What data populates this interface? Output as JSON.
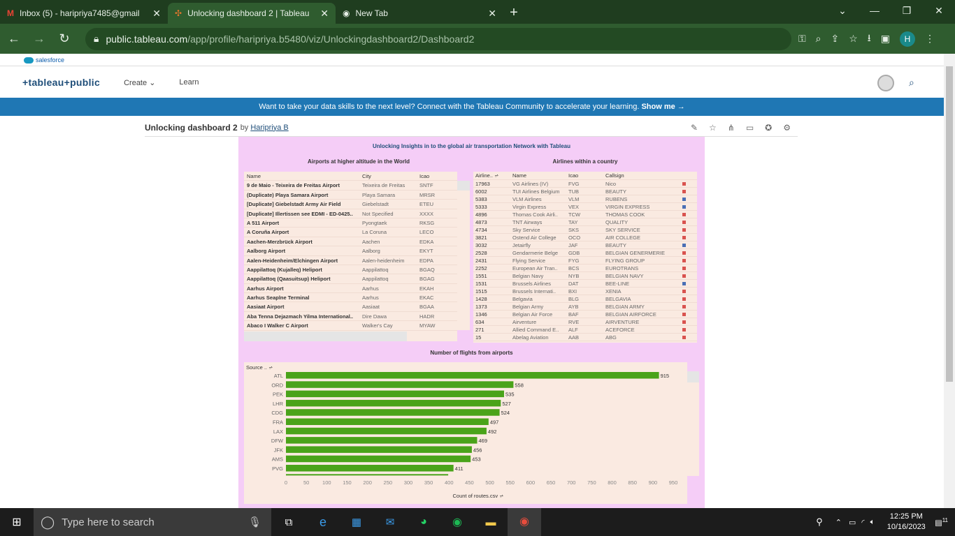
{
  "browser": {
    "tabs": [
      {
        "label": "Inbox (5) - haripriya7485@gmail",
        "icon": "gmail-icon"
      },
      {
        "label": "Unlocking dashboard 2 | Tableau",
        "icon": "tableau-icon"
      },
      {
        "label": "New Tab",
        "icon": "chrome-icon"
      }
    ],
    "url_host": "public.tableau.com",
    "url_path": "/app/profile/haripriya.b5480/viz/Unlockingdashboard2/Dashboard2",
    "profile_initial": "H"
  },
  "site": {
    "salesforce": "salesforce",
    "logo": "+tableau+public",
    "nav_create": "Create",
    "nav_learn": "Learn",
    "banner_text": "Want to take your data skills to the next level? Connect with the Tableau Community to accelerate your learning.",
    "banner_link": "Show me →"
  },
  "viz": {
    "title": "Unlocking dashboard 2",
    "by": "by",
    "author": "Haripriya B"
  },
  "dashboard": {
    "title": "Unlocking Insights in to the global air transportation  Network with Tableau",
    "airports_title": "Airports at higher altitude in the World",
    "airlines_title": "Airlines within a country",
    "flights_title": "Number of flights from airports"
  },
  "airports": {
    "headers": [
      "Name",
      "City",
      "Icao"
    ],
    "rows": [
      [
        "9 de Maio - Teixeira de Freitas Airport",
        "Teixeira de Freitas",
        "SNTF"
      ],
      [
        "(Duplicate) Playa Samara Airport",
        "Playa Samara",
        "MRSR"
      ],
      [
        "[Duplicate] Giebelstadt Army Air Field",
        "Giebelstadt",
        "ETEU"
      ],
      [
        "[Duplicate] Illertissen see EDMI - ED-0425..",
        "Not Specified",
        "XXXX"
      ],
      [
        "A 511 Airport",
        "Pyongtaek",
        "RKSG"
      ],
      [
        "A Coruña Airport",
        "La Coruna",
        "LECO"
      ],
      [
        "Aachen-Merzbrück Airport",
        "Aachen",
        "EDKA"
      ],
      [
        "Aalborg Airport",
        "Aalborg",
        "EKYT"
      ],
      [
        "Aalen-Heidenheim/Elchingen Airport",
        "Aalen-heidenheim",
        "EDPA"
      ],
      [
        "Aappilattoq (Kujalleq) Heliport",
        "Aappilattoq",
        "BGAQ"
      ],
      [
        "Aappilattoq (Qaasuitsup) Heliport",
        "Aappilattoq",
        "BGAG"
      ],
      [
        "Aarhus Airport",
        "Aarhus",
        "EKAH"
      ],
      [
        "Aarhus Seaplne Terminal",
        "Aarhus",
        "EKAC"
      ],
      [
        "Aasiaat Airport",
        "Aasiaat",
        "BGAA"
      ],
      [
        "Aba Tenna Dejazmach Yilma International..",
        "Dire Dawa",
        "HADR"
      ],
      [
        "Abaco I Walker C Airport",
        "Walker's Cay",
        "MYAW"
      ]
    ]
  },
  "airlines": {
    "headers": [
      "Airline..",
      "Name",
      "Icao",
      "Callsign"
    ],
    "rows": [
      [
        "17963",
        "VG Airlines (IV)",
        "FVG",
        "Nico",
        "red"
      ],
      [
        "6002",
        "TUI Airlines Belgium",
        "TUB",
        "BEAUTY",
        "red"
      ],
      [
        "5383",
        "VLM Airlines",
        "VLM",
        "RUBENS",
        "blue"
      ],
      [
        "5333",
        "Virgin Express",
        "VEX",
        "VIRGIN EXPRESS",
        "blue"
      ],
      [
        "4896",
        "Thomas Cook Airli..",
        "TCW",
        "THOMAS COOK",
        "red"
      ],
      [
        "4873",
        "TNT Airways",
        "TAY",
        "QUALITY",
        "red"
      ],
      [
        "4734",
        "Sky Service",
        "SKS",
        "SKY SERVICE",
        "red"
      ],
      [
        "3821",
        "Ostend Air College",
        "OCO",
        "AIR COLLEGE",
        "red"
      ],
      [
        "3032",
        "Jetairfly",
        "JAF",
        "BEAUTY",
        "blue"
      ],
      [
        "2528",
        "Gendarmerie Belge",
        "GDB",
        "BELGIAN GENERMERIE",
        "red"
      ],
      [
        "2431",
        "Flying Service",
        "FYG",
        "FLYING GROUP",
        "red"
      ],
      [
        "2252",
        "European Air Tran..",
        "BCS",
        "EUROTRANS",
        "red"
      ],
      [
        "1551",
        "Belgian Navy",
        "NYB",
        "BELGIAN NAVY",
        "red"
      ],
      [
        "1531",
        "Brussels Airlines",
        "DAT",
        "BEE-LINE",
        "blue"
      ],
      [
        "1515",
        "Brussels Internati..",
        "BXI",
        "XENIA",
        "red"
      ],
      [
        "1428",
        "Belgavia",
        "BLG",
        "BELGAVIA",
        "red"
      ],
      [
        "1373",
        "Belgian Army",
        "AYB",
        "BELGIAN ARMY",
        "red"
      ],
      [
        "1346",
        "Belgian Air Force",
        "BAF",
        "BELGIAN AIRFORCE",
        "red"
      ],
      [
        "634",
        "Airventure",
        "RVE",
        "AIRVENTURE",
        "red"
      ],
      [
        "271",
        "Allied Command E..",
        "ALF",
        "ACEFORCE",
        "red"
      ],
      [
        "15",
        "Abelag Aviation",
        "AAB",
        "ABG",
        "red"
      ]
    ]
  },
  "chart_data": {
    "type": "bar",
    "orientation": "horizontal",
    "title": "Number of flights from airports",
    "ylabel": "Source ..",
    "xlabel": "Count of routes.csv",
    "categories": [
      "ATL",
      "ORD",
      "PEK",
      "LHR",
      "CDG",
      "FRA",
      "LAX",
      "DFW",
      "JFK",
      "AMS",
      "PVG"
    ],
    "values": [
      915,
      558,
      535,
      527,
      524,
      497,
      492,
      469,
      456,
      453,
      411
    ],
    "xlim": [
      0,
      950
    ],
    "xticks": [
      0,
      50,
      100,
      150,
      200,
      250,
      300,
      350,
      400,
      450,
      500,
      550,
      600,
      650,
      700,
      750,
      800,
      850,
      900,
      950
    ],
    "color": "#4aa31a"
  },
  "taskbar": {
    "search_placeholder": "Type here to search",
    "time": "12:25 PM",
    "date": "10/16/2023",
    "notif": "11"
  },
  "colors": {
    "red": "#d9534f",
    "blue": "#4a6fb5"
  }
}
